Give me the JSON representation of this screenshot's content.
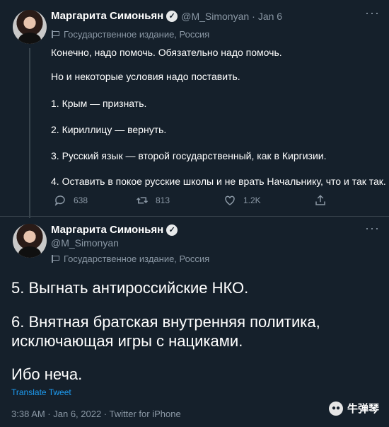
{
  "tweet1": {
    "author_name": "Маргарита Симоньян",
    "handle": "@M_Simonyan",
    "separator": "·",
    "date": "Jan 6",
    "label": "Государственное издание, Россия",
    "lines": [
      "Конечно, надо помочь. Обязательно надо помочь.",
      "Но и некоторые условия надо поставить.",
      "1. Крым — признать.",
      "2. Кириллицу — вернуть.",
      "3. Русский язык — второй государственный, как в Киргизии.",
      "4. Оставить в покое русские школы и не врать Начальнику, что и так так."
    ],
    "actions": {
      "replies": "638",
      "retweets": "813",
      "likes": "1.2K"
    }
  },
  "tweet2": {
    "author_name": "Маргарита Симоньян",
    "handle": "@M_Simonyan",
    "label": "Государственное издание, Россия",
    "lines": [
      "5. Выгнать антироссийские НКО.",
      "6. Внятная братская внутренняя политика,",
      "исключающая игры с нациками.",
      "Ибо неча."
    ],
    "translate": "Translate Tweet",
    "meta": "3:38 AM · Jan 6, 2022 · Twitter for iPhone"
  },
  "watermark": {
    "text": "牛弹琴"
  },
  "icons": {
    "verified": "verified-badge-icon",
    "label": "flag-icon",
    "reply": "reply-icon",
    "retweet": "retweet-icon",
    "like": "heart-icon",
    "share": "share-icon",
    "more": "more-icon"
  },
  "colors": {
    "background": "#15202b",
    "text": "#ffffff",
    "muted": "#8b98a5",
    "link": "#1d9bf0",
    "divider": "#38444d"
  }
}
